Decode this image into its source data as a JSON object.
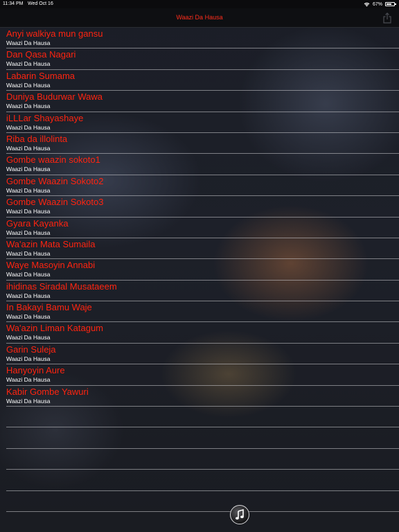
{
  "status_bar": {
    "time": "11:34 PM",
    "date": "Wed Oct 16",
    "battery_percent": "67%",
    "battery_level": 0.67,
    "wifi_icon": "wifi-icon",
    "battery_icon": "battery-icon"
  },
  "nav": {
    "title": "Waazi Da Hausa",
    "share_icon": "share-icon"
  },
  "colors": {
    "title_red": "#ff2410",
    "subtitle_white": "#ffffff",
    "nav_background": "#0e0f12"
  },
  "tracks": [
    {
      "title": "Anyi walkiya mun gansu",
      "subtitle": "Waazi Da Hausa"
    },
    {
      "title": "Dan Qasa Nagari",
      "subtitle": "Waazi Da Hausa"
    },
    {
      "title": "Labarin Sumama",
      "subtitle": "Waazi Da Hausa"
    },
    {
      "title": "Duniya Budurwar Wawa",
      "subtitle": "Waazi Da Hausa"
    },
    {
      "title": "iLLLar Shayashaye",
      "subtitle": "Waazi Da Hausa"
    },
    {
      "title": "Riba da illolinta",
      "subtitle": "Waazi Da Hausa"
    },
    {
      "title": "Gombe waazin sokoto1",
      "subtitle": "Waazi Da Hausa"
    },
    {
      "title": "Gombe Waazin Sokoto2",
      "subtitle": "Waazi Da Hausa"
    },
    {
      "title": "Gombe Waazin Sokoto3",
      "subtitle": "Waazi Da Hausa"
    },
    {
      "title": "Gyara Kayanka",
      "subtitle": "Waazi Da Hausa"
    },
    {
      "title": "Wa'azin Mata Sumaila",
      "subtitle": "Waazi Da Hausa"
    },
    {
      "title": "Waye Masoyin Annabi",
      "subtitle": "Waazi Da Hausa"
    },
    {
      "title": "ihidinas Siradal Musataeem",
      "subtitle": "Waazi Da Hausa"
    },
    {
      "title": "In Bakayi Bamu Waje",
      "subtitle": "Waazi Da Hausa"
    },
    {
      "title": "Wa'azin Liman Katagum",
      "subtitle": "Waazi Da Hausa"
    },
    {
      "title": "Garin Suleja",
      "subtitle": "Waazi Da Hausa"
    },
    {
      "title": "Hanyoyin Aure",
      "subtitle": "Waazi Da Hausa"
    },
    {
      "title": "Kabir Gombe Yawuri",
      "subtitle": "Waazi Da Hausa"
    }
  ],
  "player": {
    "icon": "music-note-icon"
  }
}
